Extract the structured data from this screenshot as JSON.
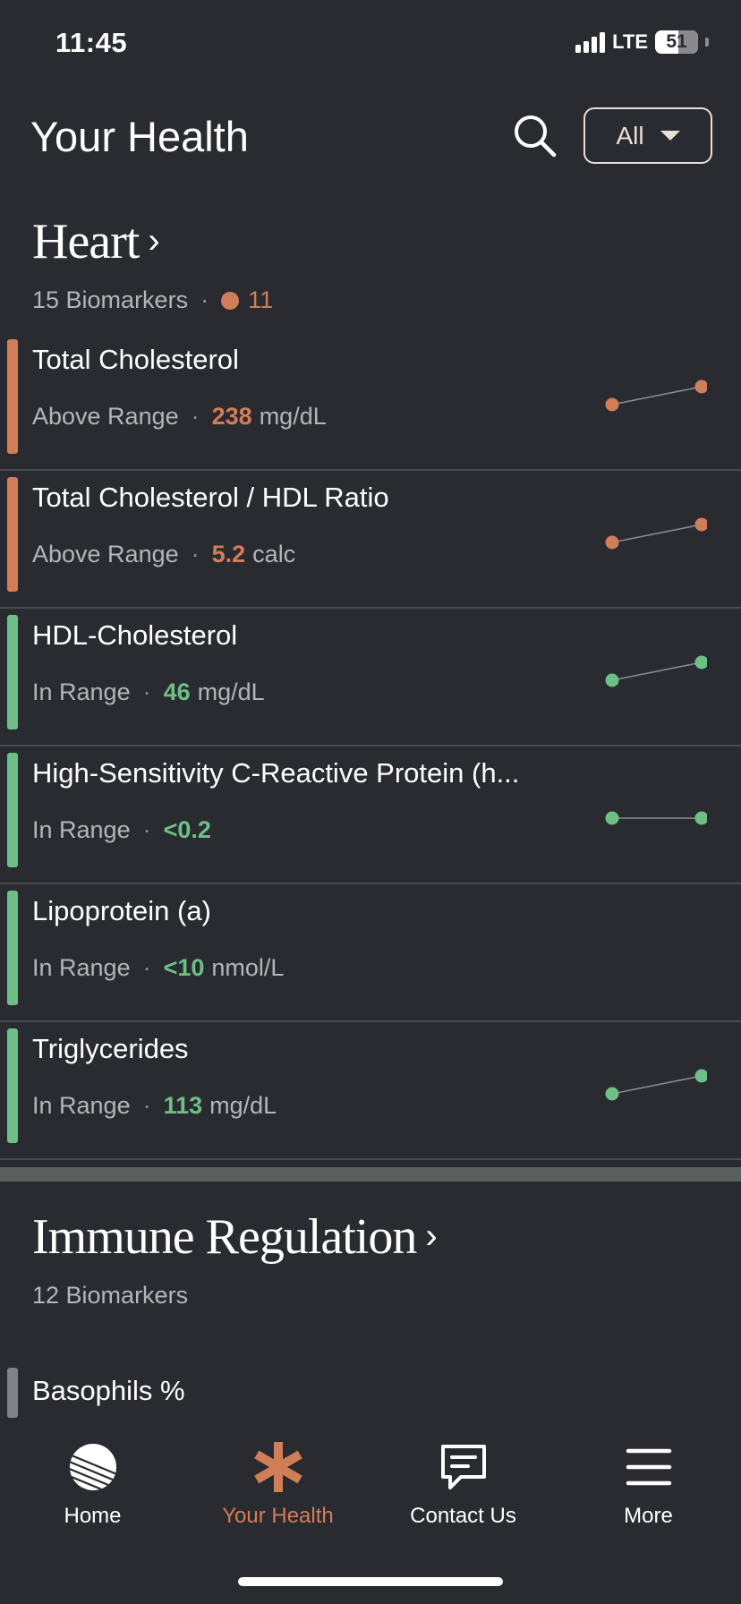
{
  "status_bar": {
    "time": "11:45",
    "network": "LTE",
    "battery": "51"
  },
  "header": {
    "title": "Your Health",
    "filter_label": "All"
  },
  "colors": {
    "above_range": "#d17d58",
    "in_range": "#6ebf85",
    "background": "#2a2b30"
  },
  "sections": [
    {
      "title": "Heart",
      "biomarker_count": "15 Biomarkers",
      "flag_count": "11",
      "biomarkers": [
        {
          "name": "Total Cholesterol",
          "status": "Above Range",
          "value": "238",
          "unit": "mg/dL",
          "level": "above",
          "trend": [
            0,
            1
          ]
        },
        {
          "name": "Total Cholesterol / HDL Ratio",
          "status": "Above Range",
          "value": "5.2",
          "unit": "calc",
          "level": "above",
          "trend": [
            0,
            1
          ]
        },
        {
          "name": "HDL-Cholesterol",
          "status": "In Range",
          "value": "46",
          "unit": "mg/dL",
          "level": "in",
          "trend": [
            0,
            1
          ]
        },
        {
          "name": "High-Sensitivity C-Reactive Protein (h...",
          "status": "In Range",
          "value": "<0.2",
          "unit": "",
          "level": "in",
          "trend": [
            0,
            0
          ]
        },
        {
          "name": "Lipoprotein (a)",
          "status": "In Range",
          "value": "<10",
          "unit": "nmol/L",
          "level": "in",
          "trend": null
        },
        {
          "name": "Triglycerides",
          "status": "In Range",
          "value": "113",
          "unit": "mg/dL",
          "level": "in",
          "trend": [
            0,
            1
          ]
        }
      ]
    },
    {
      "title": "Immune Regulation",
      "biomarker_count": "12 Biomarkers",
      "biomarkers": [
        {
          "name": "Basophils %"
        }
      ]
    }
  ],
  "tab_bar": {
    "tabs": [
      {
        "label": "Home",
        "icon": "home-globe-icon",
        "active": false
      },
      {
        "label": "Your Health",
        "icon": "asterisk-icon",
        "active": true
      },
      {
        "label": "Contact Us",
        "icon": "chat-bubble-icon",
        "active": false
      },
      {
        "label": "More",
        "icon": "hamburger-menu-icon",
        "active": false
      }
    ]
  }
}
